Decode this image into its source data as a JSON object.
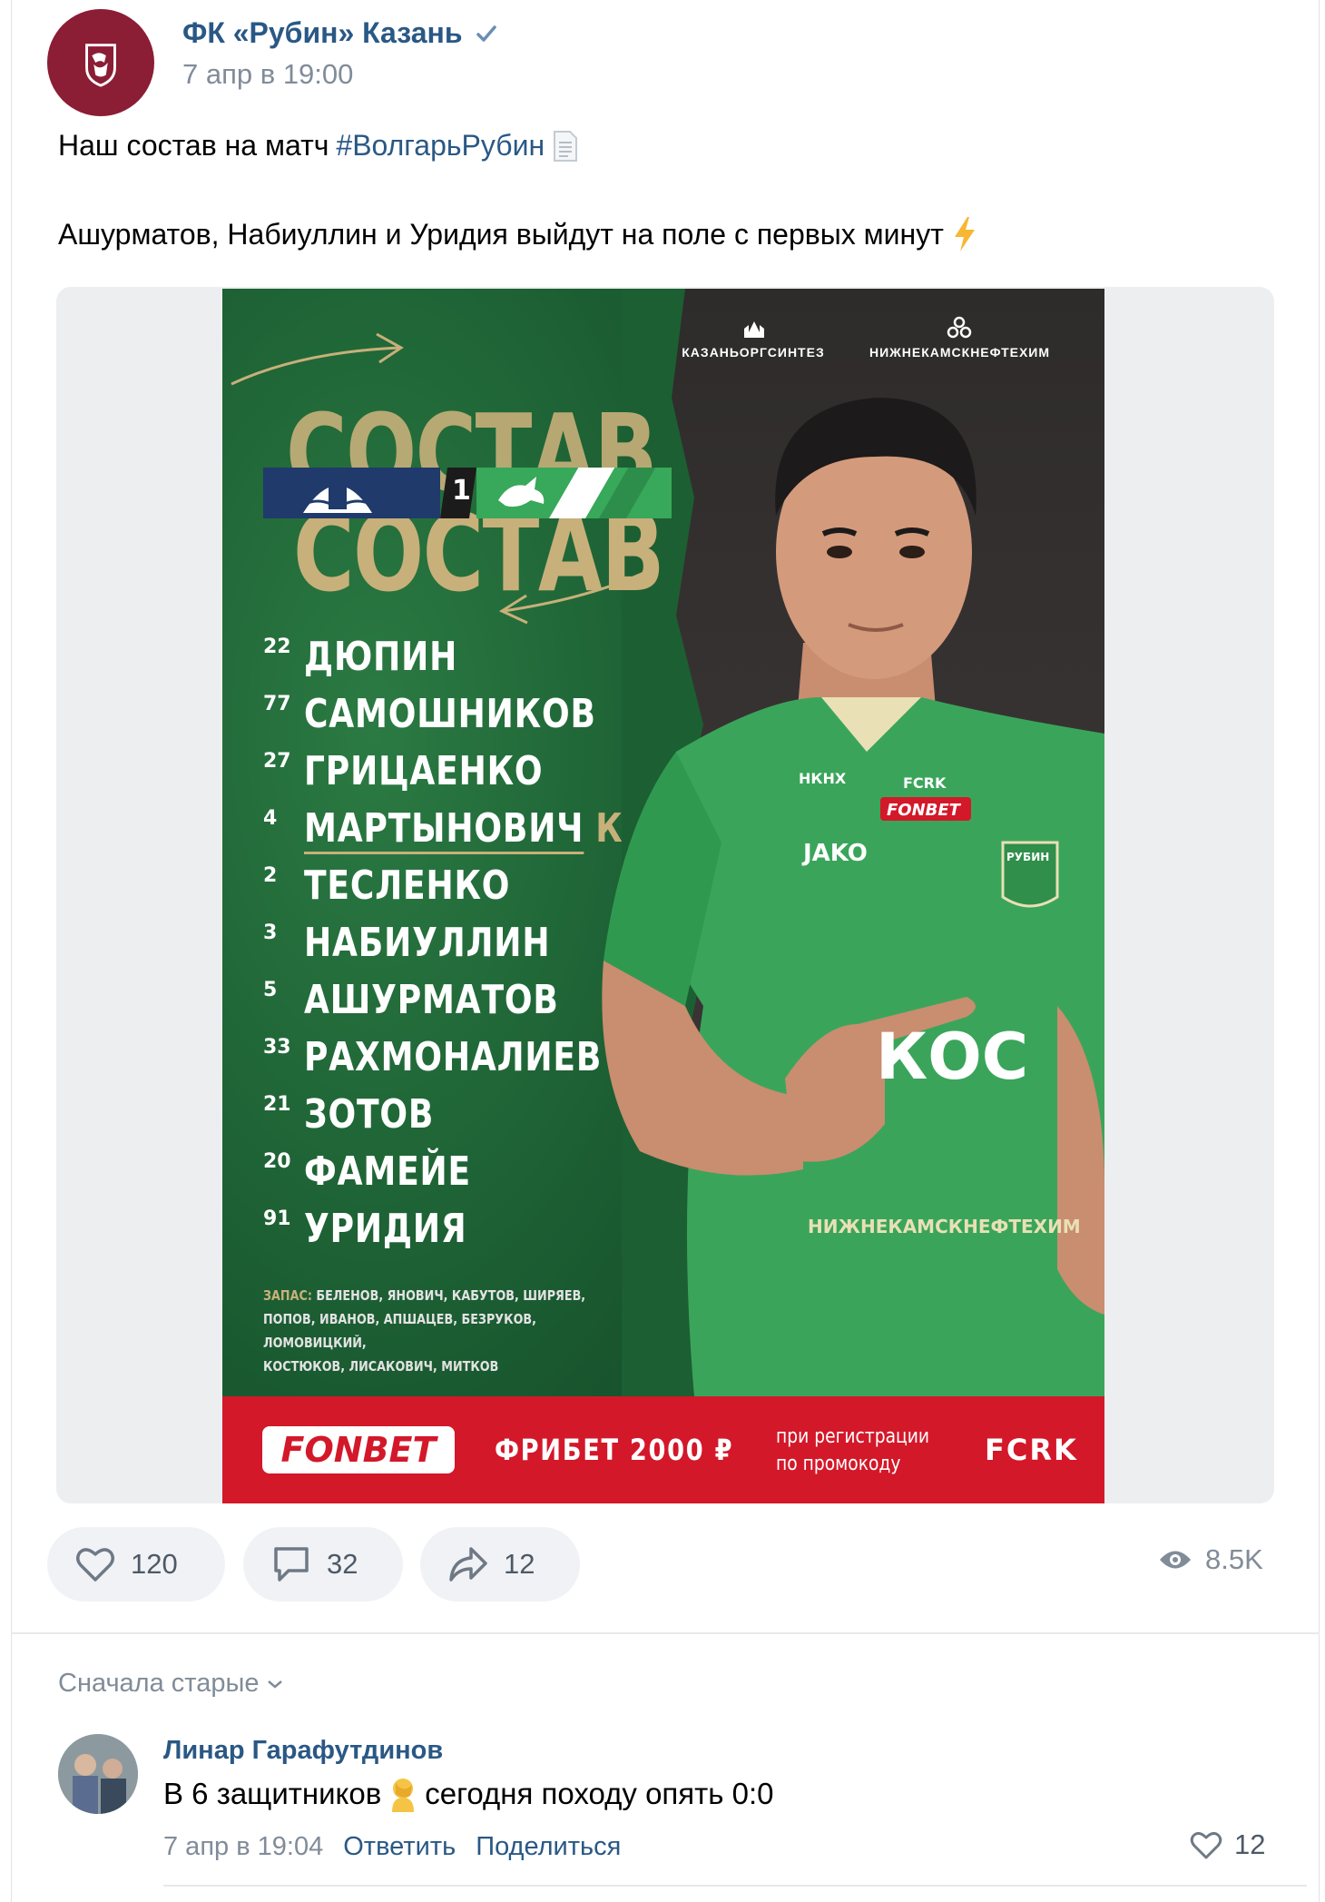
{
  "post": {
    "author": "ФК «Рубин» Казань",
    "date": "7 апр в 19:00",
    "text_line1_prefix": "Наш состав на матч",
    "hashtag": "#ВолгарьРубин",
    "text_line2": "Ашурматов, Набиуллин и Уридия выйдут на поле с первых минут"
  },
  "poster": {
    "sponsors": [
      "КАЗАНЬОРГСИНТЕЗ",
      "НИЖНЕКАМСКНЕФТЕХИМ"
    ],
    "title": "СОСТАВ",
    "match_number": "1",
    "players": [
      {
        "num": "22",
        "name": "ДЮПИН",
        "captain": ""
      },
      {
        "num": "77",
        "name": "САМОШНИКОВ",
        "captain": ""
      },
      {
        "num": "27",
        "name": "ГРИЦАЕНКО",
        "captain": ""
      },
      {
        "num": "4",
        "name": "МАРТЫНОВИЧ",
        "captain": "К"
      },
      {
        "num": "2",
        "name": "ТЕСЛЕНКО",
        "captain": ""
      },
      {
        "num": "3",
        "name": "НАБИУЛЛИН",
        "captain": ""
      },
      {
        "num": "5",
        "name": "АШУРМАТОВ",
        "captain": ""
      },
      {
        "num": "33",
        "name": "РАХМОНАЛИЕВ",
        "captain": ""
      },
      {
        "num": "21",
        "name": "ЗОТОВ",
        "captain": ""
      },
      {
        "num": "20",
        "name": "ФАМЕЙЕ",
        "captain": ""
      },
      {
        "num": "91",
        "name": "УРИДИЯ",
        "captain": ""
      }
    ],
    "subs_label": "ЗАПАС:",
    "subs_line1": "БЕЛЕНОВ, ЯНОВИЧ, КАБУТОВ, ШИРЯЕВ,",
    "subs_line2": "ПОПОВ, ИВАНОВ, АПШАЦЕВ, БЕЗРУКОВ, ЛОМОВИЦКИЙ,",
    "subs_line3": "КОСТЮКОВ, ЛИСАКОВИЧ, МИТКОВ",
    "jersey_text": {
      "brand": "JAKO",
      "fcrk": "FCRK",
      "fonbet": "FONBET",
      "sponsor_chest": "КОС",
      "lower": "НИЖНЕКАМСКНЕФТЕХИМ",
      "nknh": "НКНХ",
      "badge": "РУБИН"
    },
    "banner": {
      "logo": "FONBET",
      "freebet": "ФРИБЕТ 2000 ₽",
      "promo_line1": "при регистрации",
      "promo_line2": "по промокоду",
      "code": "FCRK"
    }
  },
  "actions": {
    "likes": "120",
    "comments": "32",
    "reposts": "12",
    "views": "8.5K"
  },
  "comments": {
    "sort_label": "Сначала старые",
    "items": [
      {
        "author": "Линар Гарафутдинов",
        "text_before": "В 6 защитников",
        "text_after": "сегодня походу опять 0:0",
        "date": "7 апр в 19:04",
        "reply": "Ответить",
        "share": "Поделиться",
        "likes": "12"
      }
    ]
  },
  "colors": {
    "link": "#2a5885",
    "club": "#8b1d35",
    "poster_green": "#1e6a3a",
    "poster_gold": "#c8b07a",
    "banner_red": "#d3182a"
  }
}
